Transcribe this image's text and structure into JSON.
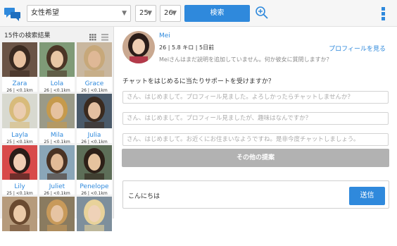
{
  "header": {
    "gender_select": "女性希望",
    "age_min": "25",
    "age_max": "26",
    "search_button": "検索"
  },
  "results": {
    "title": "15件の検索結果",
    "cards": [
      {
        "name": "Zara",
        "info": "26 | <0.1km",
        "bg": "#6a5446",
        "skin": "#e8c2a0",
        "hair": "#3a2a20"
      },
      {
        "name": "Lola",
        "info": "26 | <0.1km",
        "bg": "#7f9a77",
        "skin": "#e9c7a5",
        "hair": "#4b3526"
      },
      {
        "name": "Grace",
        "info": "26 | <0.1km",
        "bg": "#c9b79f",
        "skin": "#dfb896",
        "hair": "#c7a87a"
      },
      {
        "name": "Layla",
        "info": "25 | <0.1km",
        "bg": "#d8d9d0",
        "skin": "#ebcdb0",
        "hair": "#d8bb7b"
      },
      {
        "name": "Mila",
        "info": "25 | <0.1km",
        "bg": "#9a9a88",
        "skin": "#e6c29f",
        "hair": "#c69a4c"
      },
      {
        "name": "Julia",
        "info": "26 | <0.1km",
        "bg": "#4a5a6a",
        "skin": "#e4bfa0",
        "hair": "#3a2a1f"
      },
      {
        "name": "Lily",
        "info": "25 | <0.1km",
        "bg": "#d84a4a",
        "skin": "#f0cdb4",
        "hair": "#2a1c18"
      },
      {
        "name": "Juliet",
        "info": "26 | <0.1km",
        "bg": "#8aa6b8",
        "skin": "#e2bb97",
        "hair": "#4a3324"
      },
      {
        "name": "Penelope",
        "info": "26 | <0.1km",
        "bg": "#5d6e58",
        "skin": "#e6c39e",
        "hair": "#2d2018"
      },
      {
        "name": "",
        "info": "",
        "bg": "#b69b7c",
        "skin": "#ebcaa8",
        "hair": "#6a4a30"
      },
      {
        "name": "",
        "info": "",
        "bg": "#8a7b60",
        "skin": "#e6c4a3",
        "hair": "#c89a5a"
      },
      {
        "name": "",
        "info": "",
        "bg": "#7e8f9c",
        "skin": "#efd2b8",
        "hair": "#e8d29a"
      }
    ]
  },
  "profile": {
    "name": "Mei",
    "info": "26 | 5.8 キロ | 5日前",
    "description": "Meiさんはまだ説明を追加していません。何か彼女に質問しますか？",
    "view_profile_link": "プロフィールを見る"
  },
  "chat": {
    "support_question": "チャットをはじめるに当たりサポートを受けますか？",
    "suggestions": [
      "さん、はじめまして。プロフィール見ました。よろしかったらチャットしませんか？",
      "さん、はじめまして。プロフィール見ましたが、趣味はなんですか？",
      "さん、はじめまして。お近くにお住まいなようですね。是非今度チャットしましょう。"
    ],
    "more_button": "その他の提案",
    "message_value": "こんにちは",
    "send_button": "送信"
  },
  "colors": {
    "accent": "#2f89dc"
  }
}
